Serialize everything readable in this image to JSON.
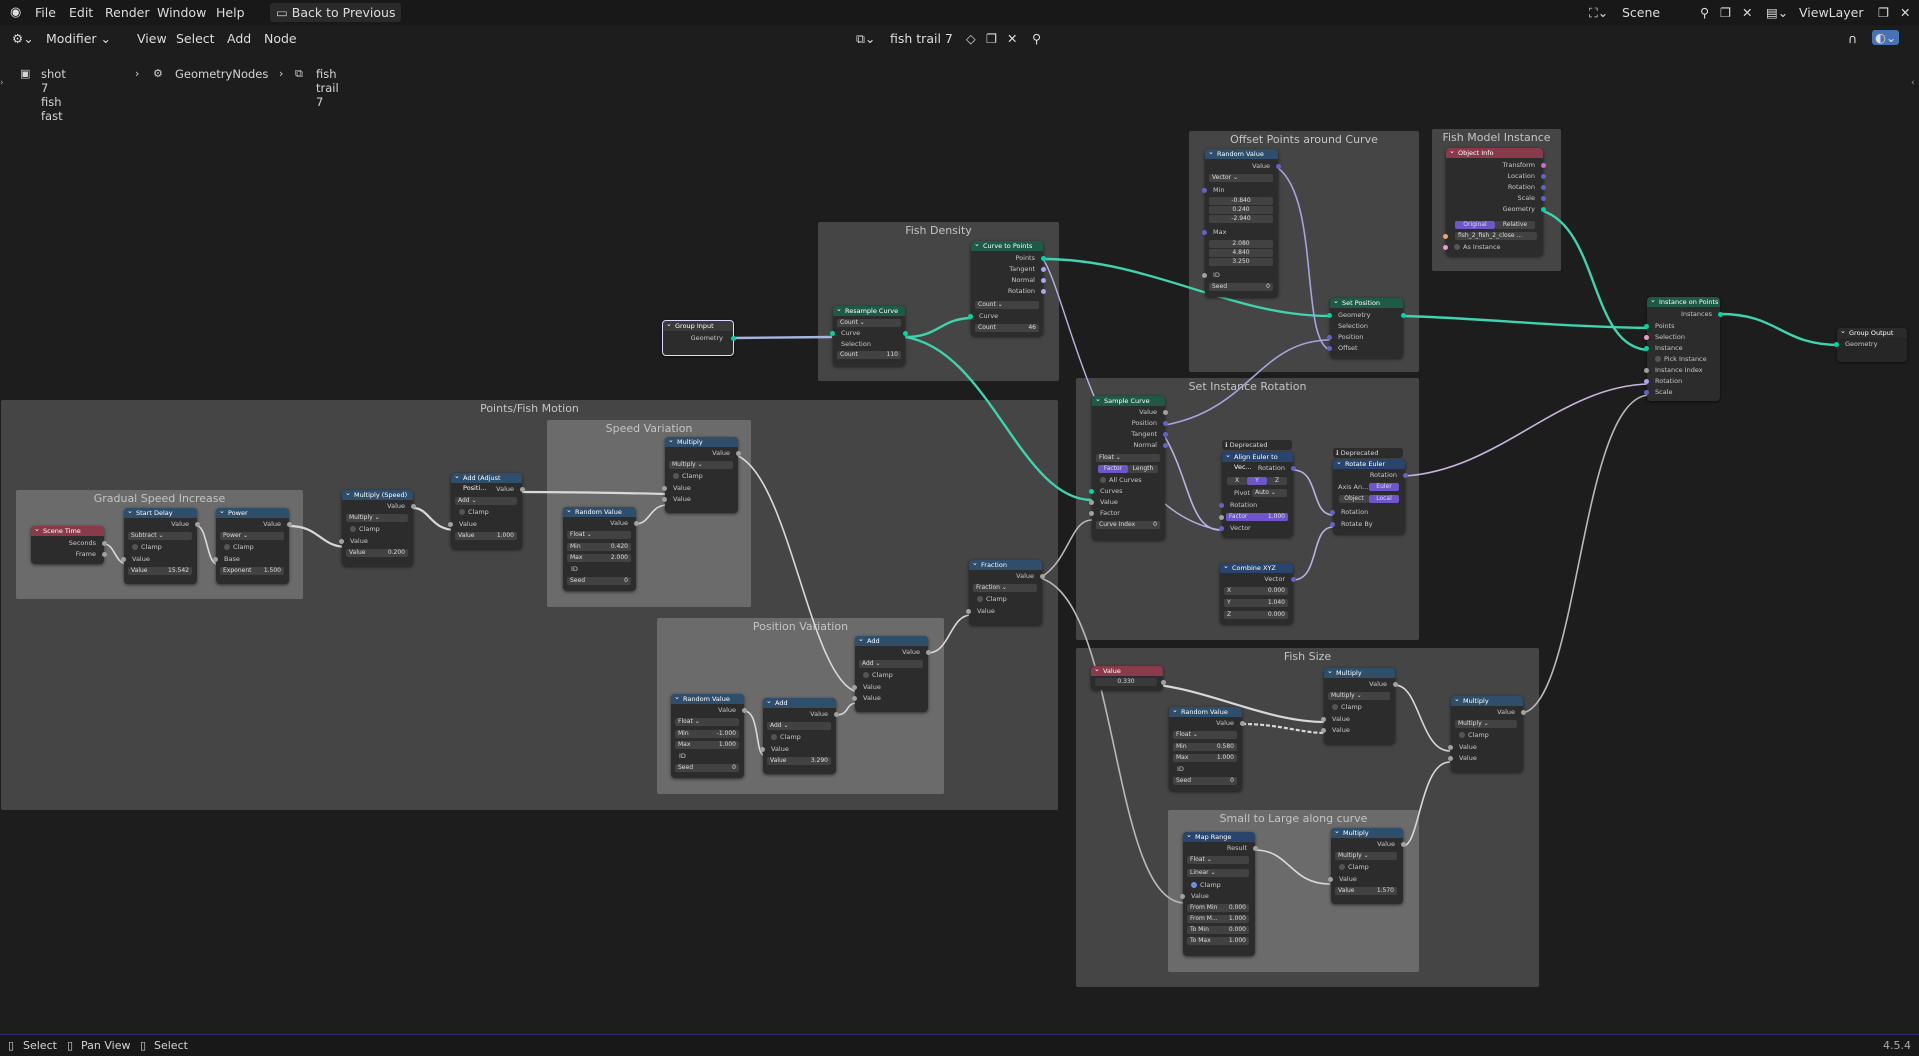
{
  "menu": {
    "file": "File",
    "edit": "Edit",
    "render": "Render",
    "window": "Window",
    "help": "Help",
    "back": "Back to Previous"
  },
  "top_right": {
    "scene": "Scene",
    "view_layer": "ViewLayer"
  },
  "header": {
    "editor": "Modifier",
    "view": "View",
    "select": "Select",
    "add": "Add",
    "node": "Node",
    "tree_name": "fish trail 7"
  },
  "breadcrumb": {
    "object": "shot 7 fish fast",
    "modifier": "GeometryNodes",
    "tree": "fish trail 7"
  },
  "frames": {
    "fish_density": "Fish Density",
    "offset": "Offset Points around Curve",
    "fish_model": "Fish Model Instance",
    "points_motion": "Points/Fish Motion",
    "speed_var": "Speed Variation",
    "gradual": "Gradual Speed Increase",
    "position_var": "Position Variation",
    "set_rot": "Set Instance Rotation",
    "fish_size": "Fish Size",
    "small_large": "Small to Large along curve"
  },
  "nodes": {
    "group_input": {
      "title": "Group Input",
      "geometry": "Geometry"
    },
    "resample": {
      "title": "Resample Curve",
      "mode": "Count",
      "curve": "Curve",
      "selection": "Selection",
      "count": "Count",
      "count_val": "110"
    },
    "curve_to_points": {
      "title": "Curve to Points",
      "points": "Points",
      "tangent": "Tangent",
      "normal": "Normal",
      "rotation": "Rotation",
      "mode": "Count",
      "curve": "Curve",
      "count": "Count",
      "count_val": "46"
    },
    "random_vec": {
      "title": "Random Value",
      "value": "Value",
      "type": "Vector",
      "min": "Min",
      "min1": "-0.840",
      "min2": "0.240",
      "min3": "-2.940",
      "max": "Max",
      "max1": "2.080",
      "max2": "4.840",
      "max3": "3.250",
      "id": "ID",
      "seed": "Seed",
      "seed_val": "0"
    },
    "set_position": {
      "title": "Set Position",
      "geometry": "Geometry",
      "selection": "Selection",
      "position": "Position",
      "offset": "Offset"
    },
    "object_info": {
      "title": "Object Info",
      "transform": "Transform",
      "location": "Location",
      "rotation": "Rotation",
      "scale": "Scale",
      "geometry": "Geometry",
      "original": "Original",
      "relative": "Relative",
      "object": "fish_2_fish_2_close ...",
      "as_instance": "As Instance"
    },
    "instance_on_points": {
      "title": "Instance on Points",
      "instances": "Instances",
      "points": "Points",
      "selection": "Selection",
      "instance": "Instance",
      "pick": "Pick Instance",
      "index": "Instance Index",
      "rotation": "Rotation",
      "scale": "Scale"
    },
    "group_output": {
      "title": "Group Output",
      "geometry": "Geometry"
    },
    "scene_time": {
      "title": "Scene Time",
      "seconds": "Seconds",
      "frame": "Frame"
    },
    "start_delay": {
      "title": "Start Delay",
      "value": "Value",
      "op": "Subtract",
      "clamp": "Clamp",
      "value_in": "Value",
      "value_val": "15.542"
    },
    "power": {
      "title": "Power",
      "value": "Value",
      "op": "Power",
      "clamp": "Clamp",
      "base": "Base",
      "exponent": "Exponent",
      "exp_val": "1.500"
    },
    "mult_speed": {
      "title": "Multiply (Speed)",
      "value": "Value",
      "op": "Multiply",
      "clamp": "Clamp",
      "value_in": "Value",
      "value_val": "0.200"
    },
    "add_adjust": {
      "title": "Add (Adjust Positi...",
      "value": "Value",
      "op": "Add",
      "clamp": "Clamp",
      "value_in": "Value",
      "value_val": "1.000"
    },
    "speed_mult": {
      "title": "Multiply",
      "value": "Value",
      "op": "Multiply",
      "clamp": "Clamp",
      "v1": "Value",
      "v2": "Value"
    },
    "random_speed": {
      "title": "Random Value",
      "value": "Value",
      "type": "Float",
      "min": "Min",
      "min_val": "0.420",
      "max": "Max",
      "max_val": "2.000",
      "id": "ID",
      "seed": "Seed",
      "seed_val": "0"
    },
    "random_pos": {
      "title": "Random Value",
      "value": "Value",
      "type": "Float",
      "min": "Min",
      "min_val": "-1.000",
      "max": "Max",
      "max_val": "1.000",
      "id": "ID",
      "seed": "Seed",
      "seed_val": "0"
    },
    "add_pos": {
      "title": "Add",
      "value": "Value",
      "op": "Add",
      "clamp": "Clamp",
      "value_in": "Value",
      "value_val": "3.290"
    },
    "add_big": {
      "title": "Add",
      "value": "Value",
      "op": "Add",
      "clamp": "Clamp",
      "v1": "Value",
      "v2": "Value"
    },
    "fraction": {
      "title": "Fraction",
      "value": "Value",
      "op": "Fraction",
      "clamp": "Clamp",
      "value_in": "Value"
    },
    "sample_curve": {
      "title": "Sample Curve",
      "value": "Value",
      "position": "Position",
      "tangent": "Tangent",
      "normal": "Normal",
      "type": "Float",
      "factor": "Factor",
      "length": "Length",
      "all_curves": "All Curves",
      "curves": "Curves",
      "value_in": "Value",
      "factor_in": "Factor",
      "curve_index": "Curve Index",
      "ci_val": "0"
    },
    "align_euler": {
      "badge": "Deprecated",
      "title": "Align Euler to Vec...",
      "rotation": "Rotation",
      "x": "X",
      "y": "Y",
      "z": "Z",
      "pivot": "Pivot",
      "auto": "Auto",
      "rotation_in": "Rotation",
      "factor": "Factor",
      "factor_val": "1.000",
      "vector": "Vector"
    },
    "rotate_euler": {
      "badge": "Deprecated",
      "title": "Rotate Euler",
      "rotation": "Rotation",
      "axis": "Axis An...",
      "euler": "Euler",
      "object": "Object",
      "local": "Local",
      "rotation_in": "Rotation",
      "rotate_by": "Rotate By"
    },
    "combine_xyz": {
      "title": "Combine XYZ",
      "vector": "Vector",
      "x": "X",
      "x_val": "0.000",
      "y": "Y",
      "y_val": "1.040",
      "z": "Z",
      "z_val": "0.000"
    },
    "value_node": {
      "title": "Value",
      "val": "0.330"
    },
    "random_size": {
      "title": "Random Value",
      "value": "Value",
      "type": "Float",
      "min": "Min",
      "min_val": "0.580",
      "max": "Max",
      "max_val": "1.000",
      "id": "ID",
      "seed": "Seed",
      "seed_val": "0"
    },
    "size_mult1": {
      "title": "Multiply",
      "value": "Value",
      "op": "Multiply",
      "clamp": "Clamp",
      "v1": "Value",
      "v2": "Value"
    },
    "size_mult2": {
      "title": "Multiply",
      "value": "Value",
      "op": "Multiply",
      "clamp": "Clamp",
      "v1": "Value",
      "v2": "Value"
    },
    "map_range": {
      "title": "Map Range",
      "result": "Result",
      "type": "Float",
      "interp": "Linear",
      "clamp": "Clamp",
      "value": "Value",
      "from_min": "From Min",
      "from_min_val": "0.000",
      "from_max": "From M...",
      "from_max_val": "1.000",
      "to_min": "To Min",
      "to_min_val": "0.000",
      "to_max": "To Max",
      "to_max_val": "1.000"
    },
    "map_mult": {
      "title": "Multiply",
      "value": "Value",
      "op": "Multiply",
      "clamp": "Clamp",
      "value_in": "Value",
      "value_val": "1.570"
    }
  },
  "status": {
    "select": "Select",
    "pan": "Pan View",
    "select2": "Select",
    "version": "4.5.4"
  }
}
